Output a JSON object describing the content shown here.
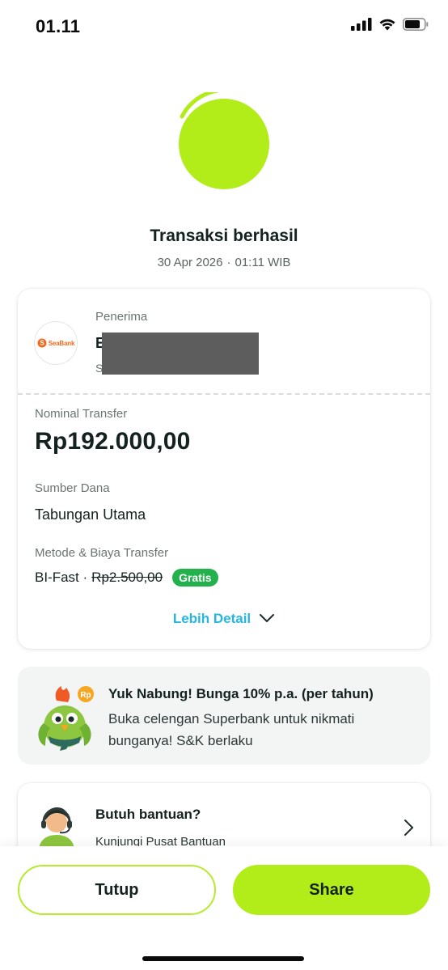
{
  "status_bar": {
    "time": "01.11"
  },
  "hero": {
    "title": "Transaksi berhasil",
    "date": "30 Apr 2026",
    "time": "01:11 WIB",
    "accent_color": "#b2ec19"
  },
  "recipient": {
    "label": "Penerima",
    "bank_logo_text": "SeaBank",
    "name_visible_char": "E",
    "sub_visible_char": "S"
  },
  "transfer": {
    "amount_label": "Nominal Transfer",
    "amount": "Rp192.000,00",
    "source_label": "Sumber Dana",
    "source_value": "Tabungan Utama",
    "method_label": "Metode & Biaya Transfer",
    "method_value": "BI-Fast ·",
    "original_fee": "Rp2.500,00",
    "free_badge": "Gratis",
    "more_detail_label": "Lebih Detail"
  },
  "promo": {
    "title": "Yuk Nabung! Bunga 10% p.a. (per tahun)",
    "description": "Buka celengan Superbank untuk nikmati bunganya! S&K berlaku",
    "coin_label": "Rp"
  },
  "help": {
    "title": "Butuh bantuan?",
    "subtitle": "Kunjungi Pusat Bantuan"
  },
  "actions": {
    "close_label": "Tutup",
    "share_label": "Share"
  }
}
